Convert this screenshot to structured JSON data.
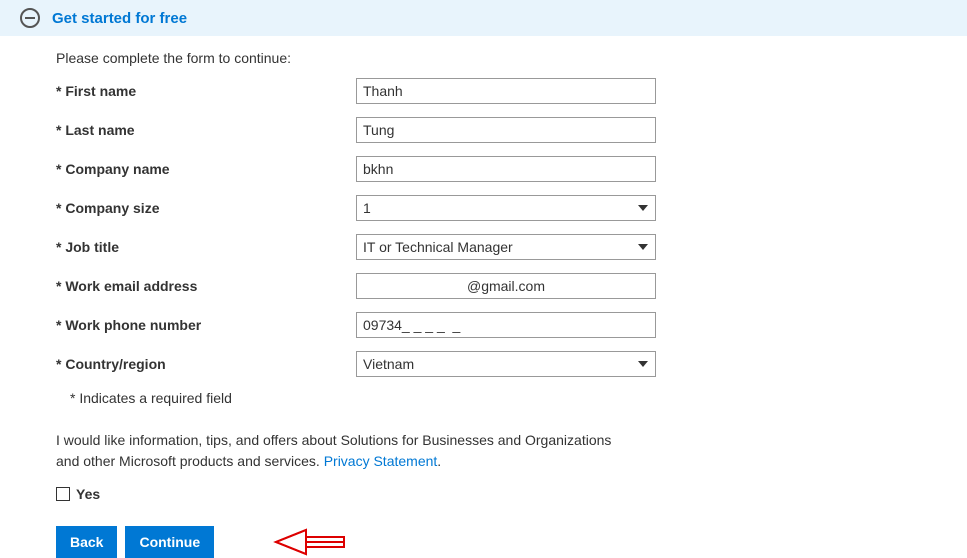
{
  "banner": {
    "title": "Get started for free"
  },
  "form": {
    "intro": "Please complete the form to continue:",
    "fields": {
      "first_name": {
        "label": "* First name",
        "value": "Thanh"
      },
      "last_name": {
        "label": "* Last name",
        "value": "Tung"
      },
      "company_name": {
        "label": "* Company name",
        "value": "bkhn"
      },
      "company_size": {
        "label": "* Company size",
        "value": "1"
      },
      "job_title": {
        "label": "* Job title",
        "value": "IT or Technical Manager"
      },
      "work_email": {
        "label": "* Work email address",
        "value": "@gmail.com"
      },
      "work_phone": {
        "label": "* Work phone number",
        "value": "09734_ _ _ _  _"
      },
      "country": {
        "label": "* Country/region",
        "value": "Vietnam"
      }
    },
    "required_note": "* Indicates a required field",
    "consent_text_a": "I would like information, tips, and offers about Solutions for Businesses and Organizations and other Microsoft products and services. ",
    "privacy_link": "Privacy Statement",
    "consent_text_b": ".",
    "checkbox_label": "Yes",
    "buttons": {
      "back": "Back",
      "continue": "Continue"
    }
  }
}
